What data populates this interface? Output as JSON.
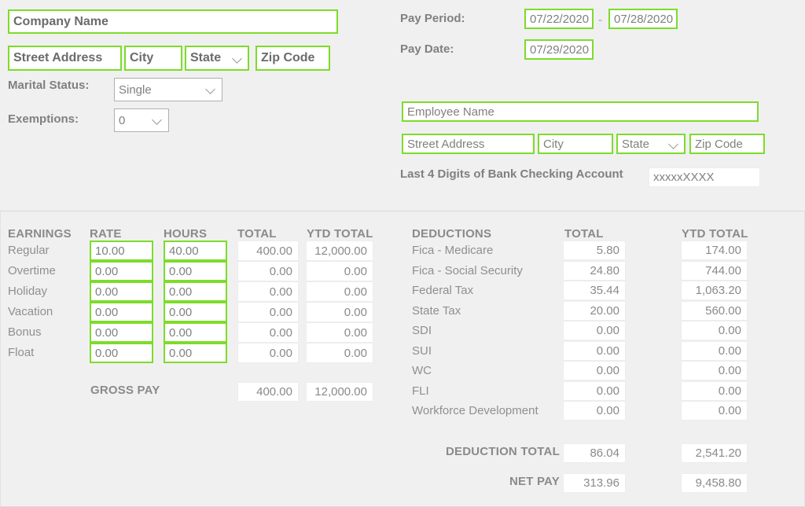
{
  "employer": {
    "company_name": "Company Name",
    "street_address": "Street Address",
    "city": "City",
    "state": "State",
    "zip_code": "Zip Code",
    "marital_status_label": "Marital Status:",
    "marital_status_value": "Single",
    "exemptions_label": "Exemptions:",
    "exemptions_value": "0"
  },
  "pay": {
    "pay_period_label": "Pay Period:",
    "pay_period_start": "07/22/2020",
    "pay_period_separator": "-",
    "pay_period_end": "07/28/2020",
    "pay_date_label": "Pay Date:",
    "pay_date": "07/29/2020"
  },
  "employee": {
    "name": "Employee Name",
    "street_address": "Street Address",
    "city": "City",
    "state": "State",
    "zip_code": "Zip Code",
    "bank_label": "Last 4 Digits of Bank Checking Account",
    "bank_value": "xxxxxXXXX"
  },
  "earnings": {
    "headers": [
      "EARNINGS",
      "RATE",
      "HOURS",
      "TOTAL",
      "YTD TOTAL"
    ],
    "rows": [
      {
        "label": "Regular",
        "rate": "10.00",
        "hours": "40.00",
        "total": "400.00",
        "ytd": "12,000.00"
      },
      {
        "label": "Overtime",
        "rate": "0.00",
        "hours": "0.00",
        "total": "0.00",
        "ytd": "0.00"
      },
      {
        "label": "Holiday",
        "rate": "0.00",
        "hours": "0.00",
        "total": "0.00",
        "ytd": "0.00"
      },
      {
        "label": "Vacation",
        "rate": "0.00",
        "hours": "0.00",
        "total": "0.00",
        "ytd": "0.00"
      },
      {
        "label": "Bonus",
        "rate": "0.00",
        "hours": "0.00",
        "total": "0.00",
        "ytd": "0.00"
      },
      {
        "label": "Float",
        "rate": "0.00",
        "hours": "0.00",
        "total": "0.00",
        "ytd": "0.00"
      }
    ],
    "gross_pay_label": "GROSS PAY",
    "gross_pay_total": "400.00",
    "gross_pay_ytd": "12,000.00"
  },
  "deductions": {
    "headers": [
      "DEDUCTIONS",
      "TOTAL",
      "YTD TOTAL"
    ],
    "rows": [
      {
        "label": "Fica - Medicare",
        "total": "5.80",
        "ytd": "174.00"
      },
      {
        "label": "Fica - Social Security",
        "total": "24.80",
        "ytd": "744.00"
      },
      {
        "label": "Federal Tax",
        "total": "35.44",
        "ytd": "1,063.20"
      },
      {
        "label": "State Tax",
        "total": "20.00",
        "ytd": "560.00"
      },
      {
        "label": "SDI",
        "total": "0.00",
        "ytd": "0.00"
      },
      {
        "label": "SUI",
        "total": "0.00",
        "ytd": "0.00"
      },
      {
        "label": "WC",
        "total": "0.00",
        "ytd": "0.00"
      },
      {
        "label": "FLI",
        "total": "0.00",
        "ytd": "0.00"
      },
      {
        "label": "Workforce Development",
        "total": "0.00",
        "ytd": "0.00"
      }
    ],
    "deduction_total_label": "DEDUCTION TOTAL",
    "deduction_total": "86.04",
    "deduction_total_ytd": "2,541.20",
    "net_pay_label": "NET PAY",
    "net_pay": "313.96",
    "net_pay_ytd": "9,458.80"
  },
  "colors": {
    "accent_green": "#7ddc2a",
    "background": "#f0f0f0",
    "field_bg": "#ffffff",
    "text_gray": "#8f8f8f"
  }
}
